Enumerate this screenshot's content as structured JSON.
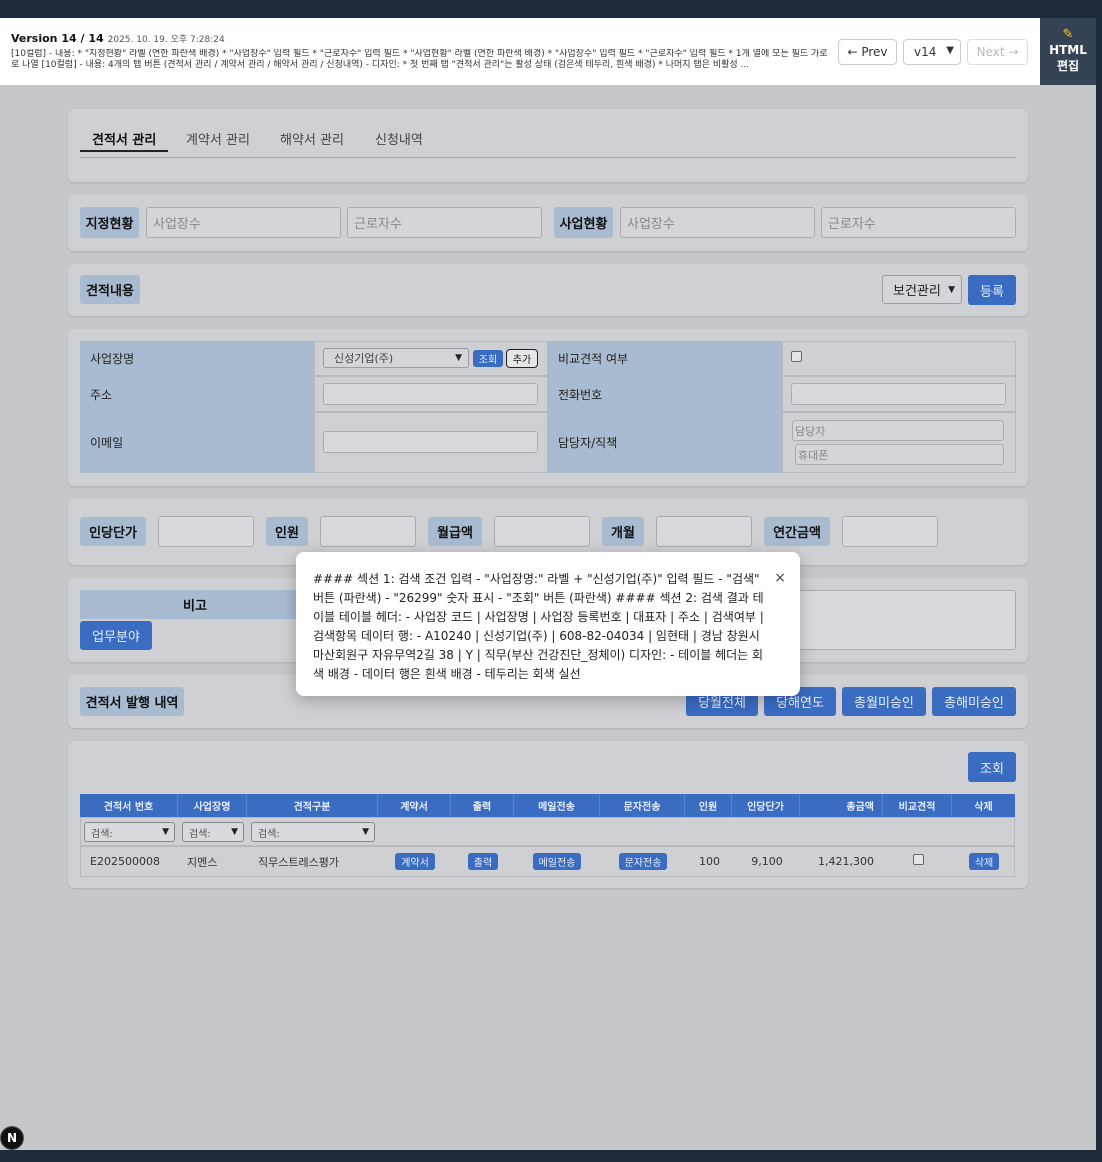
{
  "version_bar": {
    "title": "Version 14 / 14",
    "date": "2025. 10. 19. 오후 7:28:24",
    "description": "[10컬럼] - 내용: * \"지정현황\" 라벨 (연한 파란색 배경) * \"사업장수\" 입력 필드 * \"근로자수\" 입력 필드 * \"사업현황\" 라벨 (연한 파란색 배경) * \"사업장수\" 입력 필드 * \"근로자수\" 입력 필드 * 1개 열에 모든 필드 가로로 나열 [10컬럼] - 내용: 4개의 탭 버튼 (견적서 관리 / 계약서 관리 / 해약서 관리 / 신청내역) - 디자인: * 첫 번째 탭 \"견적서 관리\"는 활성 상태 (검은색 테두리, 흰색 배경) * 나머지 탭은 비활성 ...",
    "prev_label": "← Prev",
    "version_select": "v14",
    "next_label": "Next →",
    "html_edit_label_1": "HTML",
    "html_edit_label_2": "편집"
  },
  "tabs": [
    {
      "label": "견적서 관리",
      "active": true
    },
    {
      "label": "계약서 관리",
      "active": false
    },
    {
      "label": "해약서 관리",
      "active": false
    },
    {
      "label": "신청내역",
      "active": false
    }
  ],
  "status": {
    "designation_label": "지정현황",
    "designation_sites_placeholder": "사업장수",
    "designation_workers_placeholder": "근로자수",
    "business_label": "사업현황",
    "business_sites_placeholder": "사업장수",
    "business_workers_placeholder": "근로자수"
  },
  "estimate_header": {
    "label": "견적내용",
    "category_select": "보건관리",
    "register_button": "등록"
  },
  "form": {
    "site_name_label": "사업장명",
    "site_name_value": "신성기업(주)",
    "lookup_button": "조회",
    "add_button": "추가",
    "compare_label": "비교견적 여부",
    "address_label": "주소",
    "phone_label": "전화번호",
    "email_label": "이메일",
    "manager_label": "담당자/직책",
    "manager_placeholder": "담당자",
    "mobile_placeholder": "휴대폰"
  },
  "pricing": {
    "unit_price_label": "인당단가",
    "headcount_label": "인원",
    "monthly_label": "월급액",
    "months_label": "개월",
    "annual_label": "연간금액"
  },
  "remarks": {
    "label": "비고",
    "work_area_button": "업무분야"
  },
  "history": {
    "label": "견적서 발행 내역",
    "buttons": [
      "당월전체",
      "당해연도",
      "총월미승인",
      "총해미승인"
    ],
    "lookup_button": "조회"
  },
  "table": {
    "headers": [
      "견적서 번호",
      "사업장명",
      "견적구분",
      "계약서",
      "출력",
      "메일전송",
      "문자전송",
      "인원",
      "인당단가",
      "총금액",
      "비교견적",
      "삭제"
    ],
    "filters": [
      "검색:",
      "검색:",
      "검색:"
    ],
    "rows": [
      {
        "number": "E202500008",
        "site": "지멘스",
        "type": "직무스트레스평가",
        "contract_btn": "계약서",
        "print_btn": "출력",
        "mail_btn": "메일전송",
        "sms_btn": "문자전송",
        "headcount": "100",
        "unit_price": "9,100",
        "total": "1,421,300",
        "delete_btn": "삭제"
      }
    ]
  },
  "modal": {
    "text": "#### 섹션 1: 검색 조건 입력 - \"사업장명:\" 라벨 + \"신성기업(주)\" 입력 필드 - \"검색\" 버튼 (파란색) - \"26299\" 숫자 표시 - \"조회\" 버튼 (파란색) #### 섹션 2: 검색 결과 테이블 테이블 헤더: - 사업장 코드 | 사업장명 | 사업장 등록번호 | 대표자 | 주소 | 검색여부 | 검색항목 데이터 행: - A10240 | 신성기업(주) | 608-82-04034 | 임현태 | 경남 창원시 마산회원구 자유무역2길 38 | Y | 직무(부산 건강진단_정체이) 디자인: - 테이블 헤더는 회색 배경 - 데이터 행은 흰색 배경 - 테두리는 회색 실선",
    "close_glyph": "×"
  },
  "logo_letter": "N"
}
